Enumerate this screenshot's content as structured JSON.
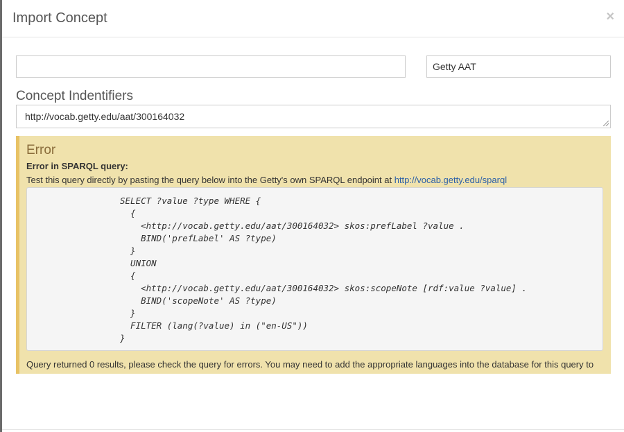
{
  "modal": {
    "title": "Import Concept",
    "close_glyph": "×"
  },
  "form": {
    "search_value": "",
    "vocabulary_selected": "Getty AAT",
    "identifiers_label": "Concept Indentifiers",
    "identifier_value": "http://vocab.getty.edu/aat/300164032"
  },
  "error": {
    "title": "Error",
    "subtitle": "Error in SPARQL query:",
    "description": "Test this query directly by pasting the query below into the Getty's own SPARQL endpoint at ",
    "endpoint_link": "http://vocab.getty.edu/sparql",
    "query": "SELECT ?value ?type WHERE {\n  {\n    <http://vocab.getty.edu/aat/300164032> skos:prefLabel ?value .\n    BIND('prefLabel' AS ?type)\n  }\n  UNION\n  {\n    <http://vocab.getty.edu/aat/300164032> skos:scopeNote [rdf:value ?value] .\n    BIND('scopeNote' AS ?type)\n  }\n  FILTER (lang(?value) in (\"en-US\"))\n}",
    "footer": "Query returned 0 results, please check the query for errors. You may need to add the appropriate languages into the database for this query to"
  },
  "colors": {
    "error_background": "#f0e2ac",
    "error_border": "#e8c265",
    "error_title": "#8a6d3b",
    "link": "#2a5fa8"
  },
  "icons": {
    "close": "close-icon",
    "resize": "resize-grip-icon"
  }
}
